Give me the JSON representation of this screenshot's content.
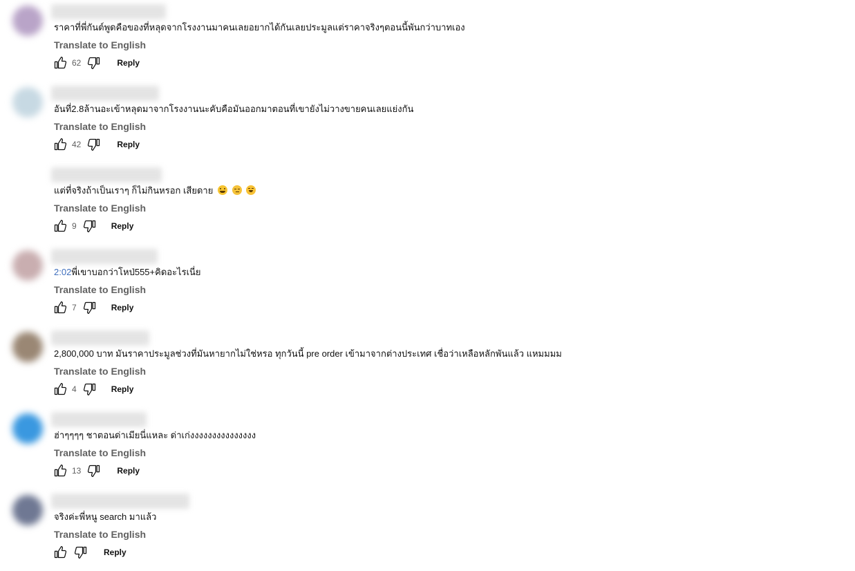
{
  "comments": [
    {
      "avatar_color": "#b9a4c8",
      "author_bar_width": 166,
      "text": "ราคาที่พี่กันต์พูดคือของที่หลุดจากโรงงานมาคนเลยอยากได้กันเลยประมูลแต่ราคาจริงๆตอนนี้พันกว่าบาทเอง",
      "translate": "Translate to English",
      "likes": "62",
      "reply": "Reply"
    },
    {
      "avatar_color": "#c7d9e3",
      "author_bar_width": 156,
      "text": "อันที่2.8ล้านอะเข้าหลุดมาจากโรงงานนะคับคือมันออกมาตอนที่เขายังไม่วางขายคนเลยแย่งกัน",
      "translate": "Translate to English",
      "likes": "42",
      "reply": "Reply"
    },
    {
      "avatar_color": "",
      "author_bar_width": 160,
      "text": "แต่ที่จริงถ้าเป็นเราๆ ก็ไม่กินหรอก เสียดาย",
      "emojis": [
        "grin-sweat-emoji",
        "smirk-emoji",
        "hug-emoji"
      ],
      "translate": "Translate to English",
      "likes": "9",
      "reply": "Reply"
    },
    {
      "avatar_color": "#c9aeb0",
      "author_bar_width": 154,
      "timestamp": "2:02",
      "text": "พี่เขาบอกว่าโหป่555+คิดอะไรเนี่ย",
      "translate": "Translate to English",
      "likes": "7",
      "reply": "Reply"
    },
    {
      "avatar_color": "#9a8774",
      "author_bar_width": 142,
      "text": "2,800,000 บาท มันราคาประมูลช่วงที่มันหายากไม่ใช่หรอ ทุกวันนี้ pre order เข้ามาจากต่างประเทศ เชื่อว่าเหลือหลักพันแล้ว แหมมมม",
      "translate": "Translate to English",
      "likes": "4",
      "reply": "Reply"
    },
    {
      "avatar_color": "#3a98e0",
      "author_bar_width": 138,
      "text": "ฮ่าๆๆๆๆ ชาตอนด่าเมียนี่แหละ ด่าเก่งงงงงงงงงงงงงงง",
      "translate": "Translate to English",
      "likes": "13",
      "reply": "Reply"
    },
    {
      "avatar_color": "#6f7893",
      "author_bar_width": 200,
      "text": "จริงค่ะพี่หนู search มาแล้ว",
      "translate": "Translate to English",
      "likes": "",
      "reply": "Reply"
    }
  ]
}
